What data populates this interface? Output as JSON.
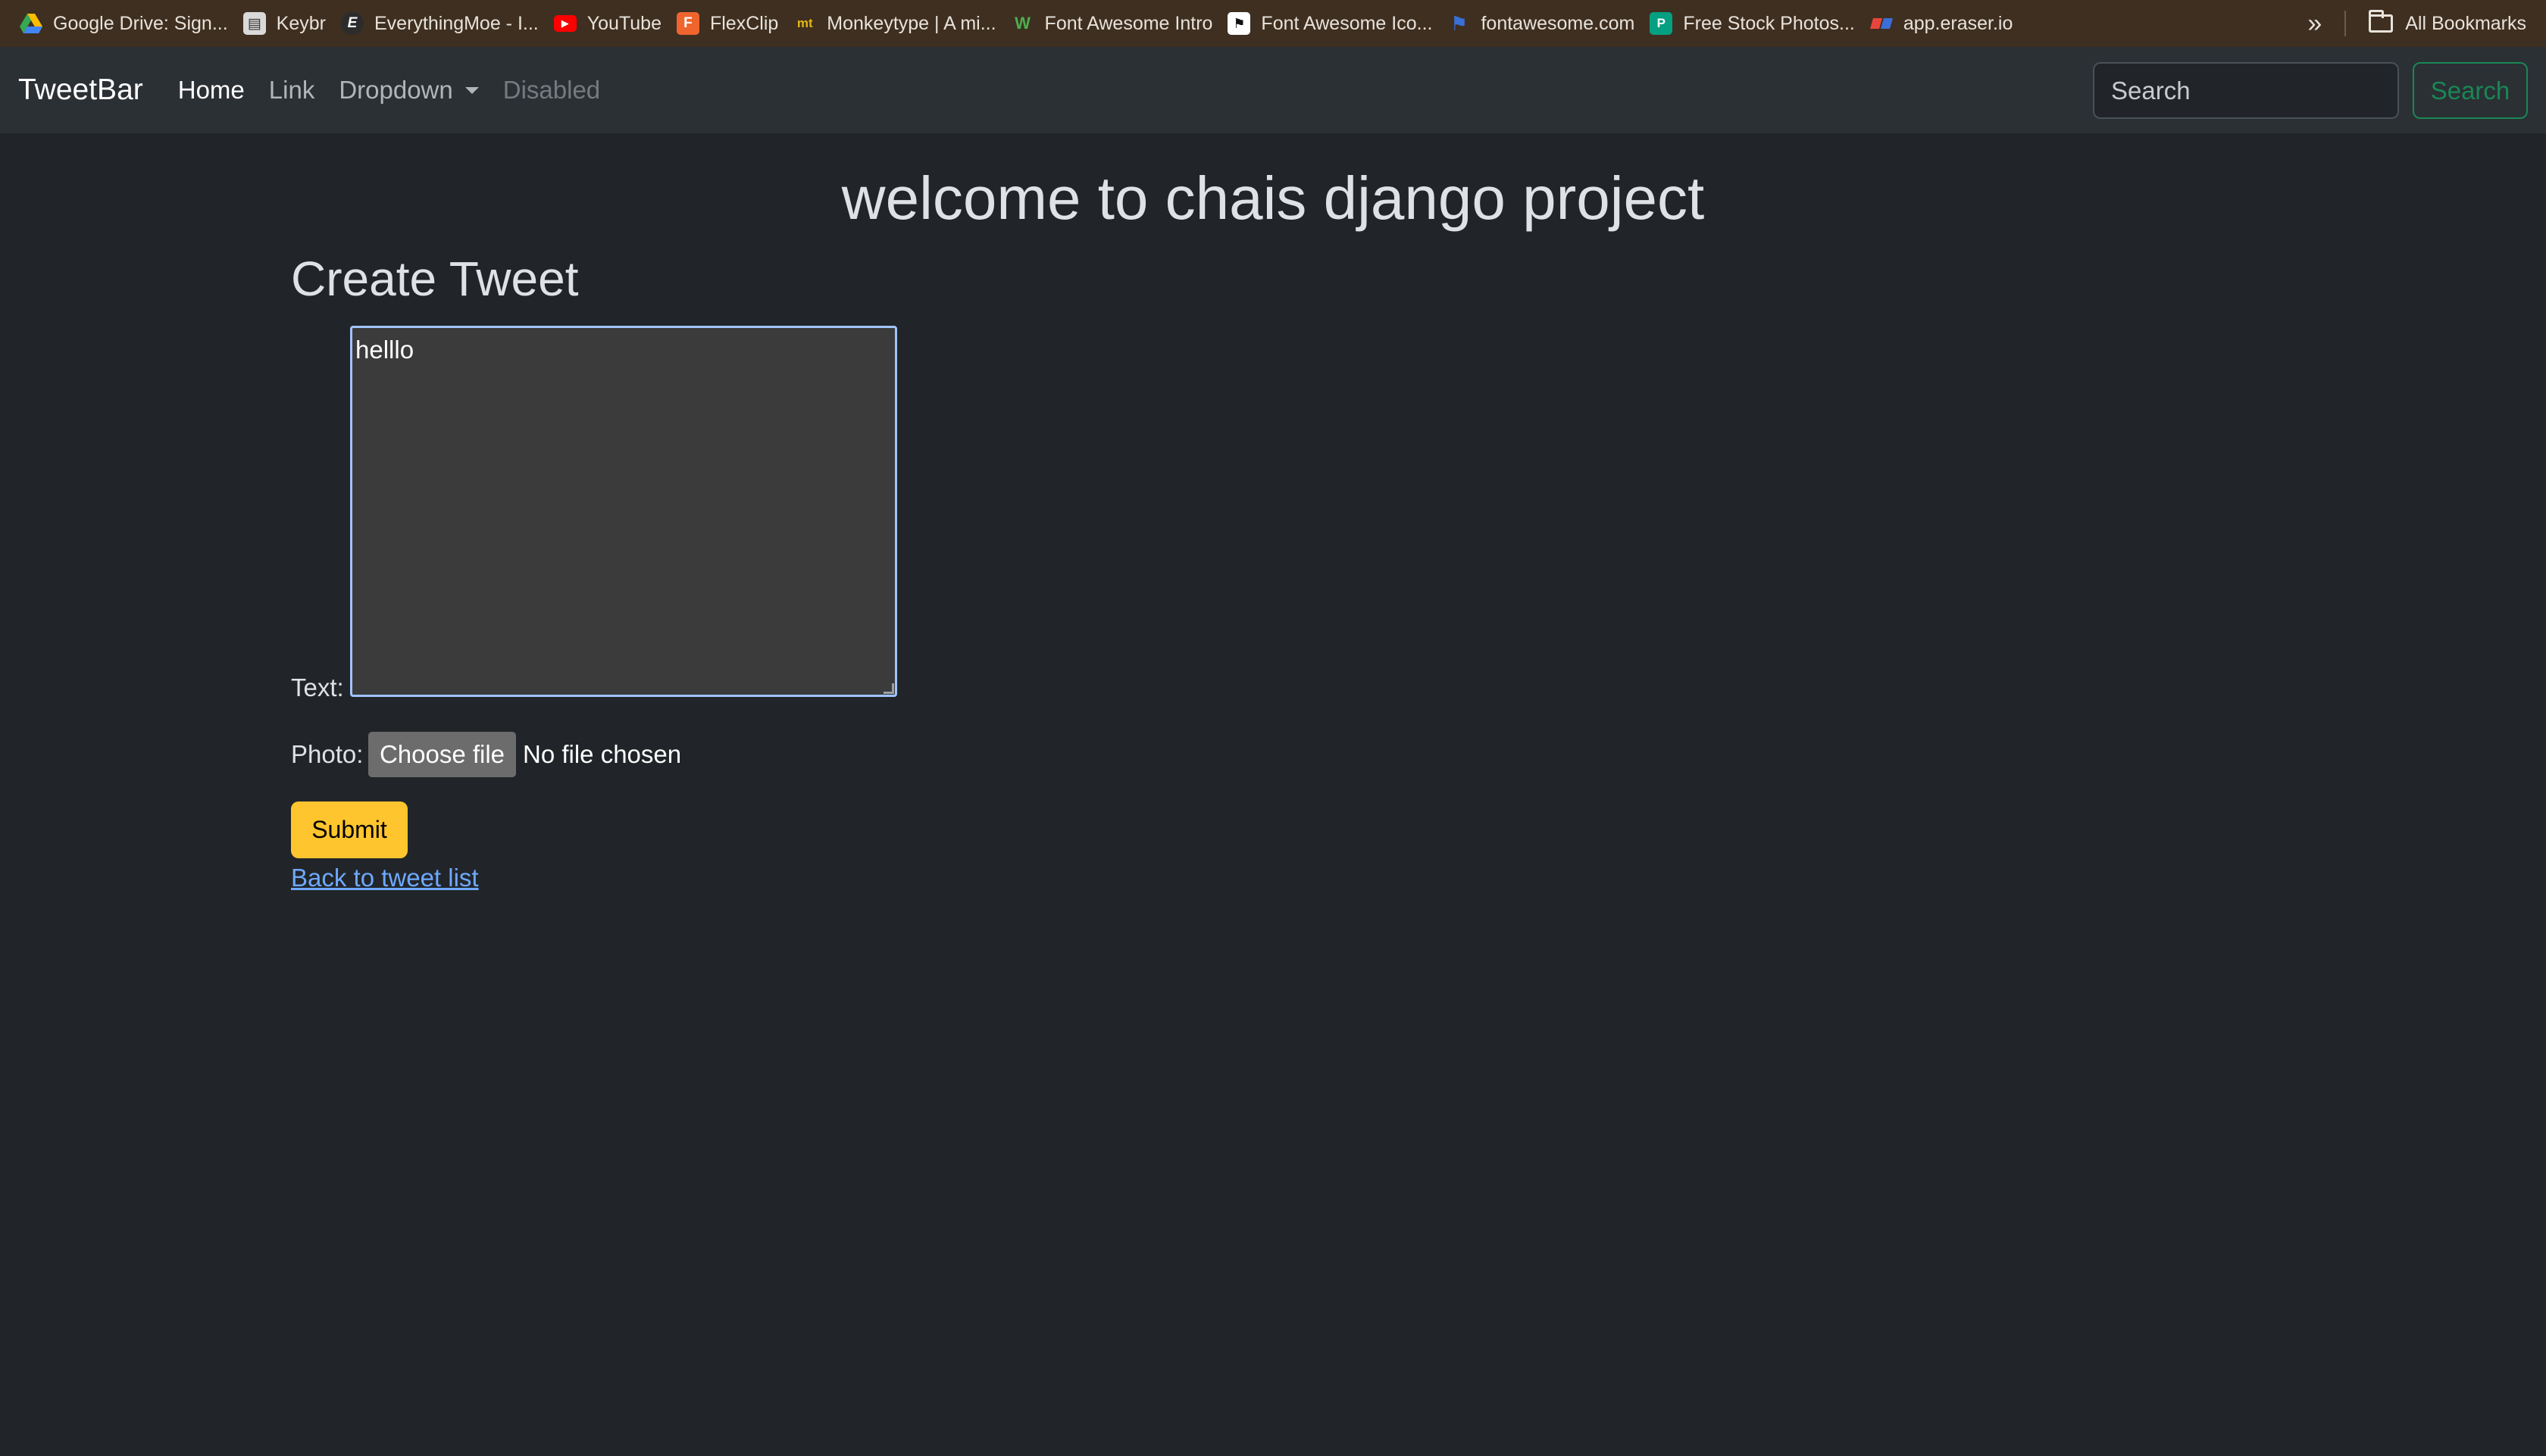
{
  "bookmarks": {
    "items": [
      {
        "label": "Google Drive: Sign...",
        "icon": "google-drive-icon",
        "color": "#34a853"
      },
      {
        "label": "Keybr",
        "icon": "keybr-icon",
        "color": "#d9d9d9"
      },
      {
        "label": "EverythingMoe - I...",
        "icon": "everythingmoe-icon",
        "color": "#2c2c2c"
      },
      {
        "label": "YouTube",
        "icon": "youtube-icon",
        "color": "#ff0000"
      },
      {
        "label": "FlexClip",
        "icon": "flexclip-icon",
        "color": "#f0642d"
      },
      {
        "label": "Monkeytype | A mi...",
        "icon": "monkeytype-icon",
        "color": "#e2b714"
      },
      {
        "label": "Font Awesome Intro",
        "icon": "font-awesome-intro-icon",
        "color": "#4caf50"
      },
      {
        "label": "Font Awesome Ico...",
        "icon": "flag-icon",
        "color": "#ffffff"
      },
      {
        "label": "fontawesome.com",
        "icon": "fontawesome-flag-icon",
        "color": "#3b6fd8"
      },
      {
        "label": "Free Stock Photos...",
        "icon": "pexels-icon",
        "color": "#05a081"
      },
      {
        "label": "app.eraser.io",
        "icon": "eraser-icon",
        "color": "#e8453c"
      }
    ],
    "overflow_icon": "»",
    "all_bookmarks_label": "All Bookmarks"
  },
  "navbar": {
    "brand": "TweetBar",
    "links": [
      {
        "label": "Home",
        "state": "active"
      },
      {
        "label": "Link",
        "state": "normal"
      },
      {
        "label": "Dropdown",
        "state": "dropdown"
      },
      {
        "label": "Disabled",
        "state": "disabled"
      }
    ],
    "search_placeholder": "Search",
    "search_button": "Search"
  },
  "main": {
    "page_title": "welcome to chais django project",
    "section_title": "Create Tweet",
    "text_label": "Text:",
    "text_value": "helllo",
    "photo_label": "Photo:",
    "file_button": "Choose file",
    "file_status": "No file chosen",
    "submit_button": "Submit",
    "back_link": "Back to tweet list"
  },
  "colors": {
    "background": "#212529",
    "navbar": "#2b3035",
    "bookmark_bar": "#3e2f21",
    "submit": "#ffc52e",
    "search_outline": "#198754",
    "link": "#6ea8fe"
  }
}
